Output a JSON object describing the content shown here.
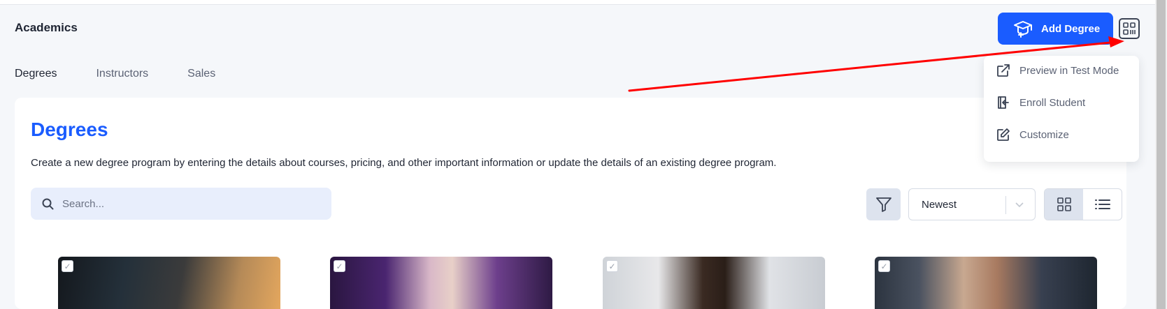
{
  "header": {
    "title": "Academics",
    "add_button_label": "Add Degree"
  },
  "tabs": [
    {
      "label": "Degrees",
      "active": true
    },
    {
      "label": "Instructors",
      "active": false
    },
    {
      "label": "Sales",
      "active": false
    }
  ],
  "main": {
    "title": "Degrees",
    "description": "Create a new degree program by entering the details about courses, pricing, and other important information or update the details of an existing degree program.",
    "search_placeholder": "Search...",
    "sort_value": "Newest"
  },
  "menu": {
    "items": [
      {
        "label": "Preview in Test Mode",
        "icon": "external-link-icon"
      },
      {
        "label": "Enroll Student",
        "icon": "enroll-icon"
      },
      {
        "label": "Customize",
        "icon": "edit-icon"
      }
    ]
  },
  "colors": {
    "accent": "#1a5cff",
    "annotation_arrow": "#ff0000"
  }
}
